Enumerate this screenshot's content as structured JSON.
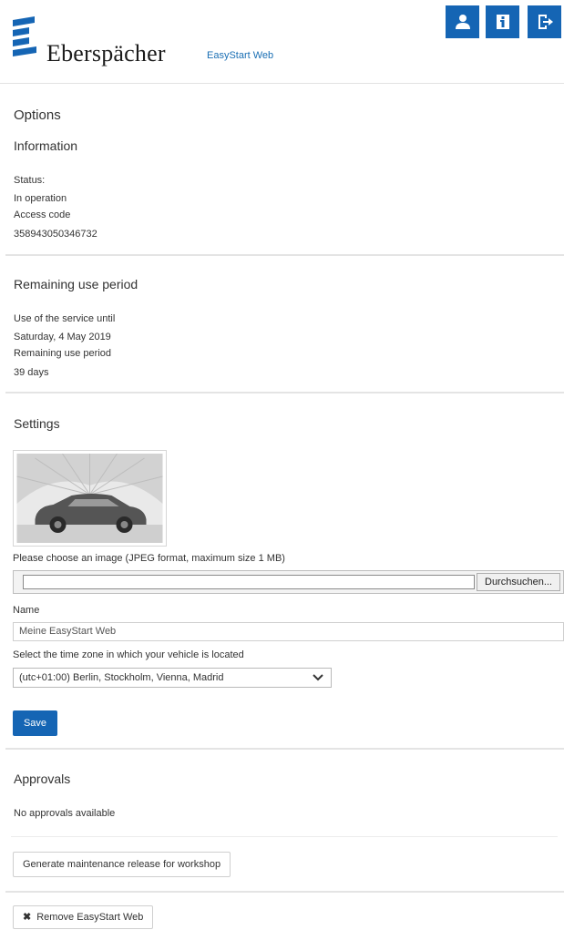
{
  "header": {
    "brand": "Eberspächer",
    "app_name": "EasyStart Web",
    "buttons": [
      {
        "icon": "user-icon"
      },
      {
        "icon": "info-icon"
      },
      {
        "icon": "logout-icon"
      }
    ],
    "accent_color": "#1565b4"
  },
  "options": {
    "title": "Options"
  },
  "information": {
    "title": "Information",
    "status_label": "Status:",
    "status_value": "In operation",
    "access_code_label": "Access code",
    "access_code_value": "358943050346732"
  },
  "remaining": {
    "title": "Remaining use period",
    "service_until_label": "Use of the service until",
    "service_until_value": "Saturday, 4 May 2019",
    "period_label": "Remaining use period",
    "period_value": "39 days"
  },
  "settings": {
    "title": "Settings",
    "image_hint": "Please choose an image (JPEG format, maximum size 1 MB)",
    "browse_label": "Durchsuchen...",
    "name_label": "Name",
    "name_value": "Meine EasyStart Web",
    "timezone_label": "Select the time zone in which your vehicle is located",
    "timezone_value": "(utc+01:00) Berlin, Stockholm, Vienna, Madrid",
    "save_label": "Save"
  },
  "approvals": {
    "title": "Approvals",
    "empty_text": "No approvals available",
    "generate_label": "Generate maintenance release for workshop"
  },
  "remove": {
    "label": "Remove EasyStart Web"
  }
}
